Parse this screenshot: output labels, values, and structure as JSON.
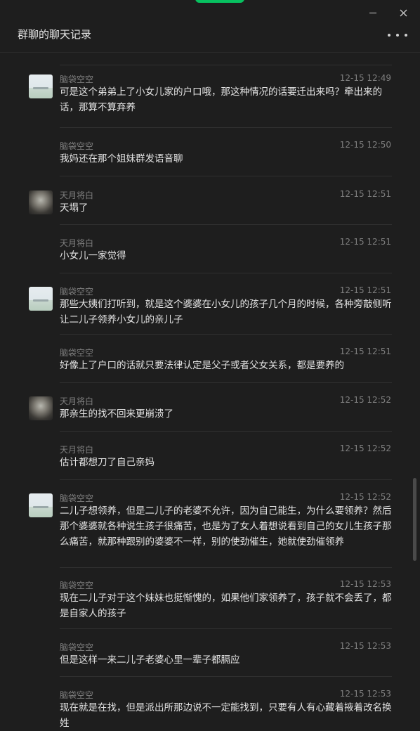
{
  "window": {
    "title": "群聊的聊天记录"
  },
  "messages": [
    {
      "sender": "脑袋空空",
      "time": "12-15 12:49",
      "avatar": "light",
      "text": "可是这个弟弟上了小女儿家的户口哦，那这种情况的话要迁出来吗？牵出来的话，那算不算弃养"
    },
    {
      "sender": "脑袋空空",
      "time": "12-15 12:50",
      "avatar": "",
      "text": "我妈还在那个姐妹群发语音聊"
    },
    {
      "sender": "天月将白",
      "time": "12-15 12:51",
      "avatar": "dark",
      "text": "天塌了"
    },
    {
      "sender": "天月将白",
      "time": "12-15 12:51",
      "avatar": "",
      "text": "小女儿一家觉得"
    },
    {
      "sender": "脑袋空空",
      "time": "12-15 12:51",
      "avatar": "light",
      "text": "那些大姨们打听到，就是这个婆婆在小女儿的孩子几个月的时候，各种旁敲侧听让二儿子领养小女儿的亲儿子"
    },
    {
      "sender": "脑袋空空",
      "time": "12-15 12:51",
      "avatar": "",
      "text": "好像上了户口的话就只要法律认定是父子或者父女关系，都是要养的"
    },
    {
      "sender": "天月将白",
      "time": "12-15 12:52",
      "avatar": "dark",
      "text": "那亲生的找不回来更崩溃了"
    },
    {
      "sender": "天月将白",
      "time": "12-15 12:52",
      "avatar": "",
      "text": "估计都想刀了自己亲妈"
    },
    {
      "sender": "脑袋空空",
      "time": "12-15 12:52",
      "avatar": "light",
      "text": "二儿子想领养，但是二儿子的老婆不允许，因为自己能生，为什么要领养？然后那个婆婆就各种说生孩子很痛苦，也是为了女人着想说看到自己的女儿生孩子那么痛苦，就那种跟别的婆婆不一样，别的使劲催生，她就使劲催领养"
    },
    {
      "sender": "脑袋空空",
      "time": "12-15 12:53",
      "avatar": "",
      "text": "现在二儿子对于这个妹妹也挺惭愧的，如果他们家领养了，孩子就不会丢了，都是自家人的孩子"
    },
    {
      "sender": "脑袋空空",
      "time": "12-15 12:53",
      "avatar": "",
      "text": "但是这样一来二儿子老婆心里一辈子都膈应"
    },
    {
      "sender": "脑袋空空",
      "time": "12-15 12:53",
      "avatar": "",
      "text": "现在就是在找，但是派出所那边说不一定能找到，只要有人有心藏着掖着改名换姓"
    }
  ]
}
